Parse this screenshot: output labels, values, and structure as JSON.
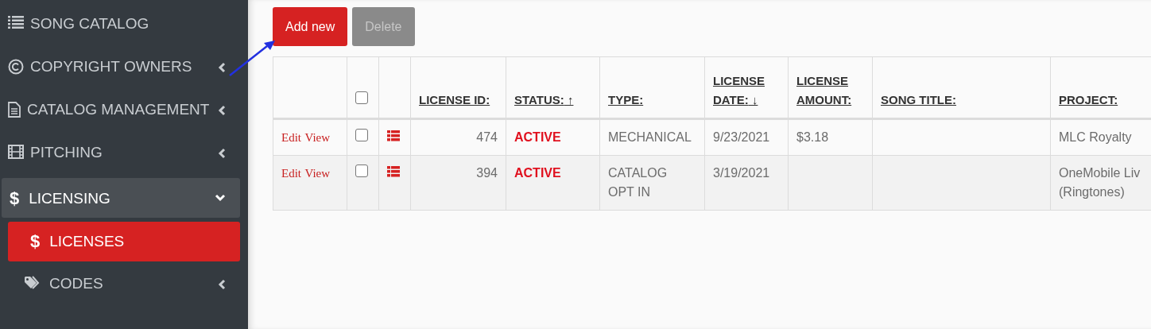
{
  "sidebar": {
    "items": [
      {
        "label": "SONG CATALOG",
        "selected": false
      },
      {
        "label": "COPYRIGHT OWNERS",
        "selected": false,
        "expanded": false
      },
      {
        "label": "CATALOG MANAGEMENT",
        "selected": false,
        "expanded": false
      },
      {
        "label": "PITCHING",
        "selected": false,
        "expanded": false
      },
      {
        "label": "LICENSING",
        "glyph": "$",
        "selected": false,
        "expanded": true,
        "children": [
          {
            "label": "LICENSES",
            "glyph": "$",
            "selected": true
          },
          {
            "label": "CODES",
            "selected": false,
            "expanded": false
          }
        ]
      }
    ]
  },
  "toolbar": {
    "buttons": [
      {
        "label": "Add new",
        "disabled": false
      },
      {
        "label": "Delete",
        "disabled": true
      }
    ]
  },
  "table": {
    "header_checkbox": {
      "checked": false
    },
    "columns": [
      {
        "label": "LICENSE ID:"
      },
      {
        "label": "STATUS:",
        "sort_arrow": "↑"
      },
      {
        "label": "TYPE:"
      },
      {
        "label": "LICENSE DATE:",
        "sort_arrow": "↓"
      },
      {
        "label": "LICENSE AMOUNT:"
      },
      {
        "label": "SONG TITLE:"
      },
      {
        "label": "PROJECT:"
      }
    ],
    "rows": [
      {
        "actions": [
          "Edit",
          "View"
        ],
        "checked": false,
        "cells": [
          "474",
          "ACTIVE",
          "MECHANICAL",
          "9/23/2021",
          "$3.18",
          "",
          "MLC Royalty"
        ]
      },
      {
        "actions": [
          "Edit",
          "View"
        ],
        "checked": false,
        "cells": [
          "394",
          "ACTIVE",
          "CATALOG OPT IN",
          "3/19/2021",
          "",
          "",
          "OneMobile Liv (Ringtones)"
        ]
      }
    ]
  }
}
